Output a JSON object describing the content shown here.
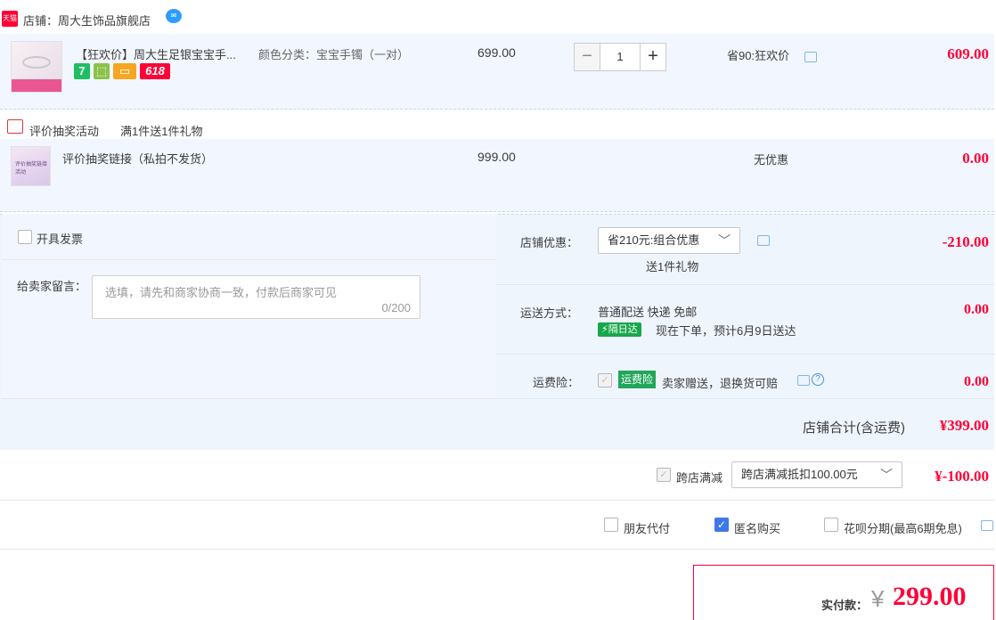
{
  "shop": {
    "tmall_badge": "天猫",
    "label": "店铺：周大生饰品旗舰店",
    "ww_icon": "chat-bubble-icon"
  },
  "item1": {
    "title": "【狂欢价】周大生足银宝宝手...",
    "sku": "颜色分类：宝宝手镯（一对）",
    "price": "699.00",
    "quantity": "1",
    "discount": "省90:狂欢价",
    "subtotal": "609.00",
    "badge_618": "618"
  },
  "gift_section": {
    "label": "评价抽奖活动",
    "rule": "满1件送1件礼物",
    "thumb_text": "评价抽奖链接活动"
  },
  "item2": {
    "title": "评价抽奖链接（私拍不发货）",
    "price": "999.00",
    "discount": "无优惠",
    "subtotal": "0.00"
  },
  "invoice": {
    "label": "开具发票"
  },
  "message": {
    "label": "给卖家留言：",
    "placeholder": "选填，请先和商家协商一致，付款后商家可见",
    "counter": "0/200"
  },
  "shop_discount": {
    "label": "店铺优惠：",
    "selected": "省210元:组合优惠",
    "gift": "送1件礼物",
    "amount": "-210.00"
  },
  "shipping": {
    "label": "运送方式：",
    "method": "普通配送 快递 免邮",
    "badge": "隔日达",
    "eta": "现在下单，预计6月9日送达",
    "amount": "0.00"
  },
  "insurance": {
    "label": "运费险：",
    "badge": "运费险",
    "desc": "卖家赠送，退换货可赔",
    "amount": "0.00"
  },
  "shop_total": {
    "label": "店铺合计(含运费)",
    "amount": "¥399.00"
  },
  "cross_store": {
    "label": "跨店满减",
    "selected": "跨店满减抵扣100.00元",
    "amount": "¥-100.00"
  },
  "options": {
    "friend_pay": "朋友代付",
    "anonymous": "匿名购买",
    "huabei": "花呗分期(最高6期免息)"
  },
  "payment": {
    "label": "实付款：",
    "currency": "¥",
    "amount": "299.00"
  },
  "colors": {
    "accent_red": "#ff0036",
    "panel_blue": "#f2f7ff",
    "check_blue": "#3e78ea"
  }
}
